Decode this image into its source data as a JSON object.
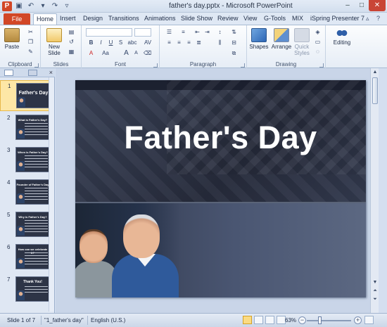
{
  "window": {
    "title": "father's day.pptx - Microsoft PowerPoint",
    "app_icon_letter": "P",
    "minimize": "–",
    "maximize": "□",
    "close": "✕"
  },
  "qat": {
    "save_icon": "save-icon",
    "undo_icon": "undo-icon",
    "redo_icon": "redo-icon"
  },
  "tabs": {
    "file": "File",
    "items": [
      "Home",
      "Insert",
      "Design",
      "Transitions",
      "Animations",
      "Slide Show",
      "Review",
      "View",
      "G-Tools",
      "MIX",
      "iSpring Presenter 7"
    ],
    "active": "Home"
  },
  "ribbon": {
    "groups": {
      "clipboard": "Clipboard",
      "slides": "Slides",
      "font": "Font",
      "paragraph": "Paragraph",
      "drawing": "Drawing"
    },
    "buttons": {
      "paste": "Paste",
      "new_slide_line1": "New",
      "new_slide_line2": "Slide",
      "shapes": "Shapes",
      "arrange": "Arrange",
      "quick_styles_line1": "Quick",
      "quick_styles_line2": "Styles",
      "editing": "Editing"
    },
    "font_buttons": {
      "bold": "B",
      "italic": "I",
      "underline": "U",
      "strike": "S",
      "abc": "abc",
      "aa": "Aa",
      "grow": "A",
      "shrink": "A"
    }
  },
  "slides_pane": {
    "thumbnails": [
      {
        "num": "1",
        "title": "Father's Day",
        "selected": true
      },
      {
        "num": "2",
        "title": "What is Father's Day?",
        "selected": false
      },
      {
        "num": "3",
        "title": "When is Father's Day?",
        "selected": false
      },
      {
        "num": "4",
        "title": "Founder of Father's Day",
        "selected": false
      },
      {
        "num": "5",
        "title": "Why is Father's Day?",
        "selected": false
      },
      {
        "num": "6",
        "title": "How can we celebrate it?",
        "selected": false
      },
      {
        "num": "7",
        "title": "Thank You!",
        "selected": false
      }
    ]
  },
  "slide": {
    "title": "Father's Day"
  },
  "statusbar": {
    "slide_info": "Slide 1 of 7",
    "theme": "\"1_father's day\"",
    "language": "English (U.S.)",
    "zoom": "63%",
    "zoom_level_fraction": 0.63
  }
}
